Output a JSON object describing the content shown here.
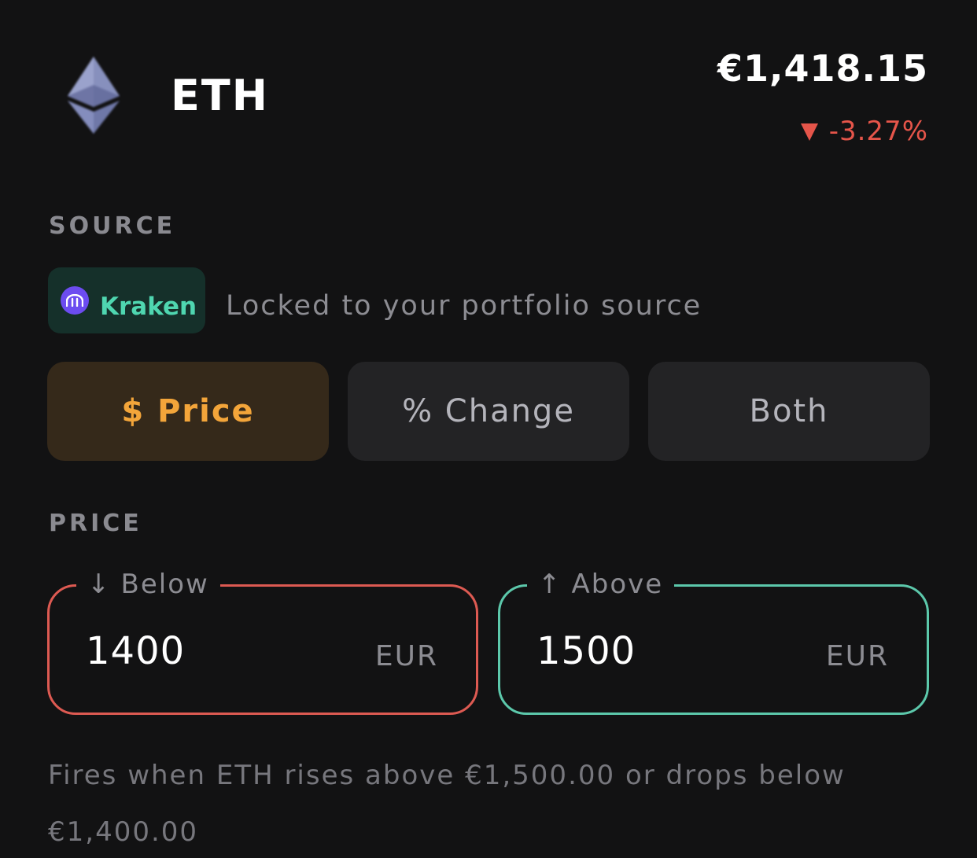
{
  "header": {
    "coin_icon": "ethereum-icon",
    "symbol": "ETH",
    "price": "€1,418.15",
    "change": "-3.27%",
    "change_color": "#e5554a"
  },
  "source": {
    "label": "SOURCE",
    "provider_icon": "kraken-icon",
    "provider": "Kraken",
    "note": "Locked to your portfolio source"
  },
  "modes": {
    "selected": "$ Price",
    "items": [
      {
        "label": "$ Price",
        "active": true
      },
      {
        "label": "% Change",
        "active": false
      },
      {
        "label": "Both",
        "active": false
      }
    ],
    "accent": "#f3a53a"
  },
  "price": {
    "label": "PRICE",
    "below": {
      "arrow": "↓",
      "label": "Below",
      "value": "1400",
      "unit": "EUR",
      "color": "#dd5a52"
    },
    "above": {
      "arrow": "↑",
      "label": "Above",
      "value": "1500",
      "unit": "EUR",
      "color": "#5cc8ab"
    }
  },
  "summary": "Fires when ETH rises above €1,500.00 or drops below €1,400.00"
}
